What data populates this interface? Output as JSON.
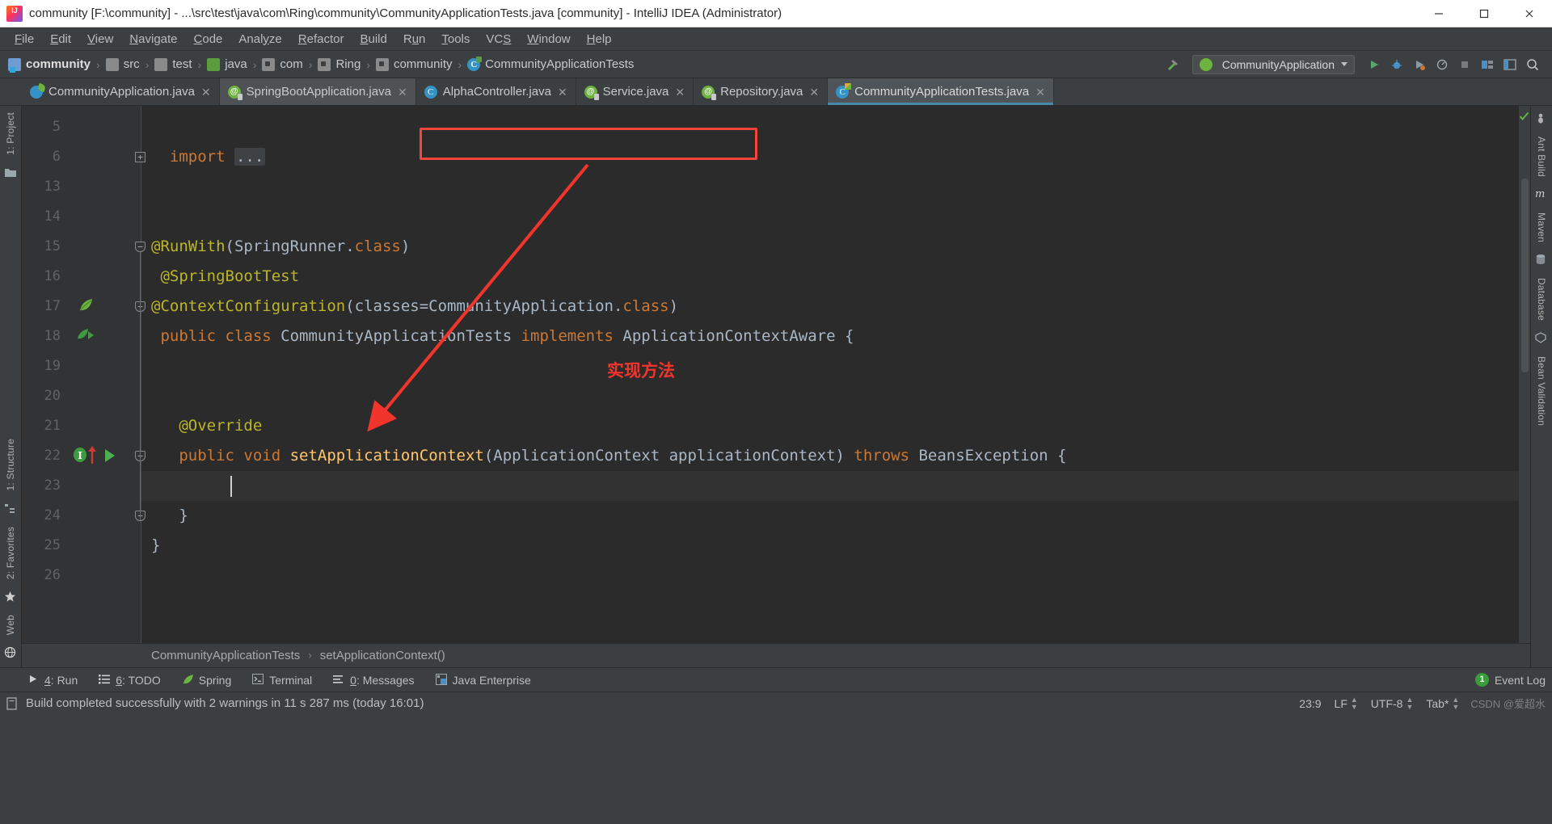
{
  "window": {
    "title": "community [F:\\community] - ...\\src\\test\\java\\com\\Ring\\community\\CommunityApplicationTests.java [community] - IntelliJ IDEA (Administrator)",
    "logo_icon": "intellij-idea-logo",
    "minimize_label": "—",
    "maximize_label": "❐",
    "close_label": "✕"
  },
  "menubar": [
    {
      "label": "File",
      "mnemonic": "F"
    },
    {
      "label": "Edit",
      "mnemonic": "E"
    },
    {
      "label": "View",
      "mnemonic": "V"
    },
    {
      "label": "Navigate",
      "mnemonic": "N"
    },
    {
      "label": "Code",
      "mnemonic": "C"
    },
    {
      "label": "Analyze",
      "mnemonic": "y"
    },
    {
      "label": "Refactor",
      "mnemonic": "R"
    },
    {
      "label": "Build",
      "mnemonic": "B"
    },
    {
      "label": "Run",
      "mnemonic": "u"
    },
    {
      "label": "Tools",
      "mnemonic": "T"
    },
    {
      "label": "VCS",
      "mnemonic": "S"
    },
    {
      "label": "Window",
      "mnemonic": "W"
    },
    {
      "label": "Help",
      "mnemonic": "H"
    }
  ],
  "navbar": {
    "crumbs": [
      {
        "label": "community",
        "icon": "module-icon",
        "bold": true
      },
      {
        "label": "src",
        "icon": "folder-icon",
        "bold": false
      },
      {
        "label": "test",
        "icon": "folder-icon",
        "bold": false
      },
      {
        "label": "java",
        "icon": "source-root-icon",
        "bold": false
      },
      {
        "label": "com",
        "icon": "package-icon",
        "bold": false
      },
      {
        "label": "Ring",
        "icon": "package-icon",
        "bold": false
      },
      {
        "label": "community",
        "icon": "package-icon",
        "bold": false
      },
      {
        "label": "CommunityApplicationTests",
        "icon": "test-class-icon",
        "bold": false
      }
    ],
    "separator": "›",
    "run_config": "CommunityApplication",
    "run_config_icon": "spring-boot-icon",
    "build_icon": "build-hammer-icon",
    "buttons": [
      {
        "name": "run-button",
        "icon": "run-triangle-icon"
      },
      {
        "name": "debug-button",
        "icon": "debug-bug-icon"
      },
      {
        "name": "run-with-coverage-button",
        "icon": "coverage-icon"
      },
      {
        "name": "profile-button",
        "icon": "profiler-icon"
      },
      {
        "name": "stop-button",
        "icon": "stop-square-icon"
      },
      {
        "name": "attach-debugger-button",
        "icon": "attach-icon"
      },
      {
        "name": "open-ide-settings-button",
        "icon": "layout-icon"
      },
      {
        "name": "search-everywhere-button",
        "icon": "search-icon"
      }
    ]
  },
  "tabs": [
    {
      "label": "CommunityApplication.java",
      "icon": "spring-class-icon",
      "state": "inactive",
      "close": "✕"
    },
    {
      "label": "SpringBootApplication.java",
      "icon": "annotation-icon",
      "state": "highlighted",
      "close": "✕"
    },
    {
      "label": "AlphaController.java",
      "icon": "class-icon",
      "state": "inactive",
      "close": "✕"
    },
    {
      "label": "Service.java",
      "icon": "annotation-icon",
      "state": "inactive",
      "close": "✕"
    },
    {
      "label": "Repository.java",
      "icon": "annotation-icon",
      "state": "inactive",
      "close": "✕"
    },
    {
      "label": "CommunityApplicationTests.java",
      "icon": "test-class-icon",
      "state": "active",
      "close": "✕"
    }
  ],
  "left_toolstrip": [
    {
      "label": "1: Project",
      "name": "tool-window-project"
    },
    {
      "label": "1: Structure",
      "name": "tool-window-structure"
    },
    {
      "label": "2: Favorites",
      "name": "tool-window-favorites"
    },
    {
      "label": "Web",
      "name": "tool-window-web"
    }
  ],
  "right_toolstrip": [
    {
      "label": "Ant Build",
      "name": "tool-window-ant-build"
    },
    {
      "label": "Maven",
      "name": "tool-window-maven"
    },
    {
      "label": "Database",
      "name": "tool-window-database"
    },
    {
      "label": "Bean Validation",
      "name": "tool-window-bean-validation"
    }
  ],
  "editor": {
    "line_numbers": [
      "5",
      "6",
      "13",
      "14",
      "15",
      "16",
      "17",
      "18",
      "19",
      "20",
      "21",
      "22",
      "23",
      "24",
      "25",
      "26"
    ],
    "folded_placeholder": "...",
    "lines": [
      {
        "num": "5",
        "tokens": []
      },
      {
        "num": "6",
        "tokens": [
          {
            "t": "import",
            "c": "kw"
          },
          {
            "t": " ",
            "c": "plain"
          },
          {
            "t": "...",
            "c": "fold-ph"
          }
        ]
      },
      {
        "num": "13",
        "tokens": []
      },
      {
        "num": "14",
        "tokens": []
      },
      {
        "num": "15",
        "tokens": [
          {
            "t": "@RunWith",
            "c": "anno"
          },
          {
            "t": "(SpringRunner.",
            "c": "typ"
          },
          {
            "t": "class",
            "c": "kw"
          },
          {
            "t": ")",
            "c": "typ"
          }
        ]
      },
      {
        "num": "16",
        "tokens": [
          {
            "t": "@SpringBootTest",
            "c": "anno"
          }
        ]
      },
      {
        "num": "17",
        "tokens": [
          {
            "t": "@ContextConfiguration",
            "c": "anno"
          },
          {
            "t": "(classes=CommunityApplication.",
            "c": "typ"
          },
          {
            "t": "class",
            "c": "kw"
          },
          {
            "t": ")",
            "c": "typ"
          }
        ]
      },
      {
        "num": "18",
        "tokens": [
          {
            "t": "public class",
            "c": "kw"
          },
          {
            "t": " CommunityApplicationTests ",
            "c": "typ"
          },
          {
            "t": "implements",
            "c": "kw"
          },
          {
            "t": " ApplicationContextAware",
            "c": "typ"
          },
          {
            "t": " {",
            "c": "plain"
          }
        ]
      },
      {
        "num": "19",
        "tokens": []
      },
      {
        "num": "20",
        "tokens": []
      },
      {
        "num": "21",
        "tokens": [
          {
            "t": "@Override",
            "c": "anno"
          }
        ]
      },
      {
        "num": "22",
        "tokens": [
          {
            "t": "public void ",
            "c": "kw"
          },
          {
            "t": "setApplicationContext",
            "c": "fn"
          },
          {
            "t": "(ApplicationContext applicationContext) ",
            "c": "typ"
          },
          {
            "t": "throws",
            "c": "kw"
          },
          {
            "t": " BeansException {",
            "c": "typ"
          }
        ]
      },
      {
        "num": "23",
        "tokens": []
      },
      {
        "num": "24",
        "tokens": [
          {
            "t": "}",
            "c": "plain"
          }
        ]
      },
      {
        "num": "25",
        "tokens": [
          {
            "t": "}",
            "c": "plain"
          }
        ]
      },
      {
        "num": "26",
        "tokens": []
      }
    ],
    "gutter_icons": [
      {
        "name": "spring-bean-icon",
        "line": "17"
      },
      {
        "name": "spring-bean-override-icon",
        "line": "18"
      },
      {
        "name": "implementing-method-icon",
        "line": "22"
      },
      {
        "name": "override-arrow-icon",
        "line": "22"
      },
      {
        "name": "run-test-icon",
        "line": "22"
      }
    ],
    "annotations": {
      "box_target": "implements ApplicationContextAware",
      "note_text": "实现方法",
      "note_color": "#f2352c"
    },
    "breadcrumbs": [
      "CommunityApplicationTests",
      "setApplicationContext()"
    ],
    "breadcrumb_separator": "›",
    "inspection_status_icon": "inspections-ok-check"
  },
  "bottom_tool_bar": [
    {
      "label": "4: Run",
      "mnemonic": "4",
      "icon": "run-triangle-icon",
      "name": "tool-window-run"
    },
    {
      "label": "6: TODO",
      "mnemonic": "6",
      "icon": "todo-list-icon",
      "name": "tool-window-todo"
    },
    {
      "label": "Spring",
      "mnemonic": "",
      "icon": "spring-leaf-icon",
      "name": "tool-window-spring"
    },
    {
      "label": "Terminal",
      "mnemonic": "",
      "icon": "terminal-icon",
      "name": "tool-window-terminal"
    },
    {
      "label": "0: Messages",
      "mnemonic": "0",
      "icon": "messages-icon",
      "name": "tool-window-messages"
    },
    {
      "label": "Java Enterprise",
      "mnemonic": "",
      "icon": "java-enterprise-icon",
      "name": "tool-window-java-enterprise"
    }
  ],
  "event_log": {
    "label": "Event Log",
    "count": "1"
  },
  "statusbar": {
    "message": "Build completed successfully with 2 warnings in 11 s 287 ms (today 16:01)",
    "message_icon": "build-status-icon",
    "caret_position": "23:9",
    "line_separator": "LF",
    "encoding": "UTF-8",
    "indent": "Tab*",
    "watermark": "CSDN @爱超水"
  },
  "colors": {
    "editor_bg": "#2b2b2b",
    "gutter_bg": "#313335",
    "chrome_bg": "#3c3f41",
    "annotation_yellow": "#bbb529",
    "keyword_orange": "#cc7832",
    "identifier": "#a9b7c6",
    "method_yellow": "#ffc66d",
    "accent_red": "#f6453c",
    "tab_underline": "#4a88a8"
  }
}
